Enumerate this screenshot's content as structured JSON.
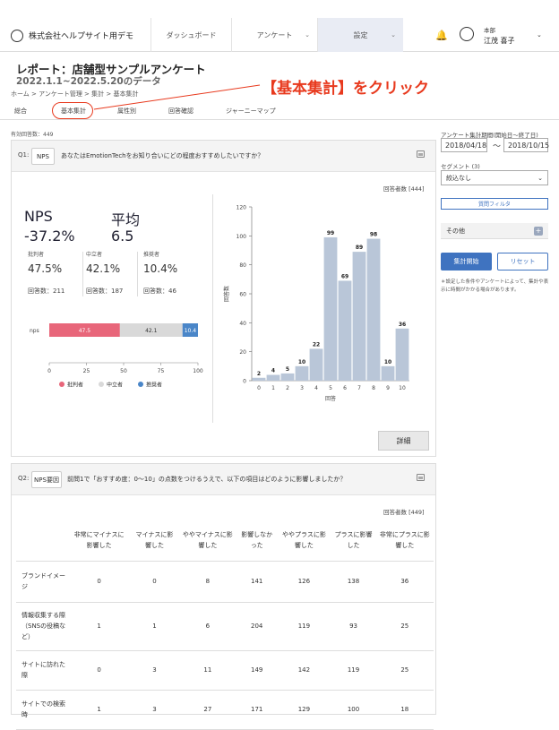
{
  "header": {
    "company": "株式会社ヘルプサイト用デモ",
    "nav": [
      {
        "label": "ダッシュボード",
        "has_dropdown": false
      },
      {
        "label": "アンケート",
        "has_dropdown": true
      },
      {
        "label": "設定",
        "has_dropdown": true
      }
    ],
    "user_dept": "本部",
    "user_name": "江茂 喜子"
  },
  "report": {
    "title": "レポート：店舗型サンプルアンケート",
    "period": "2022.1.1~2022.5.20のデータ",
    "breadcrumb": "ホーム > アンケート管理 > 集計 > 基本集計"
  },
  "annotation": "【基本集計】をクリック",
  "tabs": [
    "総合",
    "基本集計",
    "属性別",
    "回答確認",
    "ジャーニーマップ"
  ],
  "valid_count": "有効回答数：449",
  "q1": {
    "label": "Q1:",
    "tag": "NPS",
    "text": "あなたはEmotionTechをお知り合いにどの程度おすすめしたいですか？",
    "responses": "回答者数 [444]",
    "nps_label": "NPS",
    "nps_value": "-37.2%",
    "avg_label": "平均",
    "avg_value": "6.5",
    "groups": [
      {
        "name": "批判者",
        "pct": "47.5%",
        "count": "回答数：211",
        "color": "#e8667a"
      },
      {
        "name": "中立者",
        "pct": "42.1%",
        "count": "回答数：187",
        "color": "#d9d9d9"
      },
      {
        "name": "推奨者",
        "pct": "10.4%",
        "count": "回答数：46",
        "color": "#4a86c8"
      }
    ],
    "stack": {
      "row_label": "nps",
      "values": [
        47.5,
        42.1,
        10.4
      ],
      "labels": [
        "47.5",
        "42.1",
        "10.4"
      ],
      "ticks": [
        "0",
        "25",
        "50",
        "75",
        "100"
      ]
    },
    "detail_button": "詳細"
  },
  "chart_data": {
    "type": "bar",
    "categories": [
      "0",
      "1",
      "2",
      "3",
      "4",
      "5",
      "6",
      "7",
      "8",
      "9",
      "10"
    ],
    "values": [
      2,
      4,
      5,
      10,
      22,
      99,
      69,
      89,
      98,
      10,
      36
    ],
    "xlabel": "回答",
    "ylabel": "回答数",
    "ylim": [
      0,
      120
    ],
    "yticks": [
      "0",
      "20",
      "40",
      "60",
      "80",
      "100",
      "120"
    ],
    "bar_color": "#b9c6d8"
  },
  "q2": {
    "label": "Q2:",
    "tag": "NPS要因",
    "text": "前問1で「おすすめ度：0～10」の点数をつけるうえで、以下の項目はどのように影響しましたか？",
    "responses": "回答者数 [449]",
    "columns": [
      "非常にマイナスに影響した",
      "マイナスに影響した",
      "ややマイナスに影響した",
      "影響しなかった",
      "ややプラスに影響した",
      "プラスに影響した",
      "非常にプラスに影響した"
    ],
    "rows": [
      {
        "label": "ブランドイメージ",
        "values": [
          "0",
          "0",
          "8",
          "141",
          "126",
          "138",
          "36"
        ]
      },
      {
        "label": "情報収集する際（SNSの役稿など）",
        "values": [
          "1",
          "1",
          "6",
          "204",
          "119",
          "93",
          "25"
        ]
      },
      {
        "label": "サイトに訪れた際",
        "values": [
          "0",
          "3",
          "11",
          "149",
          "142",
          "119",
          "25"
        ]
      },
      {
        "label": "サイトでの検索時",
        "values": [
          "1",
          "3",
          "27",
          "171",
          "129",
          "100",
          "18"
        ]
      }
    ]
  },
  "sidebar": {
    "period_label": "アンケート集計期間(開始日～終了日)",
    "date_from": "2018/04/18",
    "date_sep": "〜",
    "date_to": "2018/10/15",
    "segment_label": "セグメント (3)",
    "segment_value": "絞込なし",
    "filter_button": "質問フィルタ",
    "other_label": "その他",
    "start_button": "集計開始",
    "reset_button": "リセット",
    "note": "＊設定した条件やアンケートによって、集計や表示に時間がかかる場合があります。"
  }
}
